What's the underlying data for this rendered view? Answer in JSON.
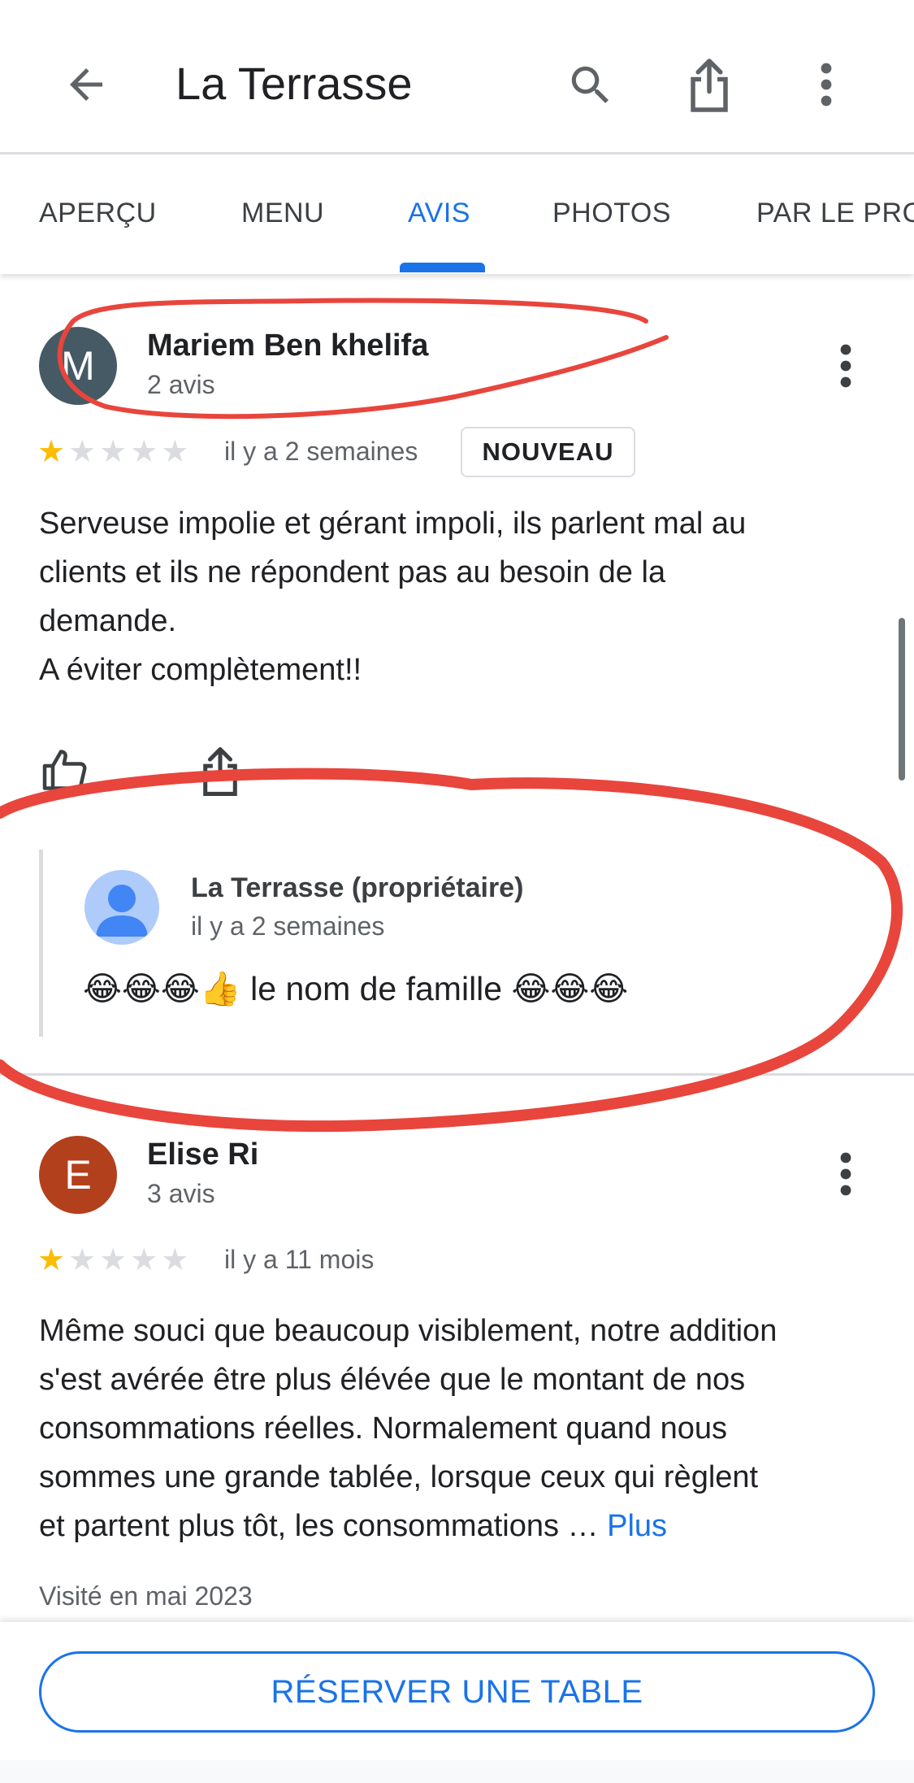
{
  "header": {
    "title": "La Terrasse",
    "back_icon": "arrow-back-icon",
    "search_icon": "search-icon",
    "share_icon": "share-icon",
    "more_icon": "more-vert-icon"
  },
  "tabs": [
    {
      "label": "APERÇU",
      "active": false
    },
    {
      "label": "MENU",
      "active": false
    },
    {
      "label": "AVIS",
      "active": true
    },
    {
      "label": "PHOTOS",
      "active": false
    },
    {
      "label": "PAR LE PRO",
      "active": false
    }
  ],
  "reviews": [
    {
      "avatar_letter": "M",
      "avatar_color": "#455a64",
      "name": "Mariem Ben khelifa",
      "count": "2 avis",
      "rating": 1,
      "max_rating": 5,
      "date": "il y a 2 semaines",
      "badge": "NOUVEAU",
      "text": "Serveuse impolie et gérant impoli, ils parlent mal au\nclients et ils ne répondent pas au besoin de la\ndemande.\nA éviter complètement!!",
      "owner_reply": {
        "name": "La Terrasse (propriétaire)",
        "date": "il y a 2 semaines",
        "text": "😂😂😂👍 le nom de famille 😂😂😂"
      }
    },
    {
      "avatar_letter": "E",
      "avatar_color": "#b3401c",
      "name": "Elise Ri",
      "count": "3 avis",
      "rating": 1,
      "max_rating": 5,
      "date": "il y a 11 mois",
      "text": "Même souci que beaucoup visiblement, notre addition\ns'est avérée être plus élévée que le montant de nos\nconsommations réelles. Normalement quand nous\nsommes une grande tablée, lorsque ceux qui règlent\net partent plus tôt, les consommations … ",
      "more_label": "Plus",
      "visited": "Visité en mai 2023"
    }
  ],
  "actions": {
    "like_icon": "thumb-up-icon",
    "share_icon": "share-icon"
  },
  "bottom": {
    "reserve_label": "RÉSERVER UNE TABLE"
  },
  "colors": {
    "accent": "#1a73e8",
    "star": "#fbbc04",
    "annotation": "#e8453c"
  }
}
